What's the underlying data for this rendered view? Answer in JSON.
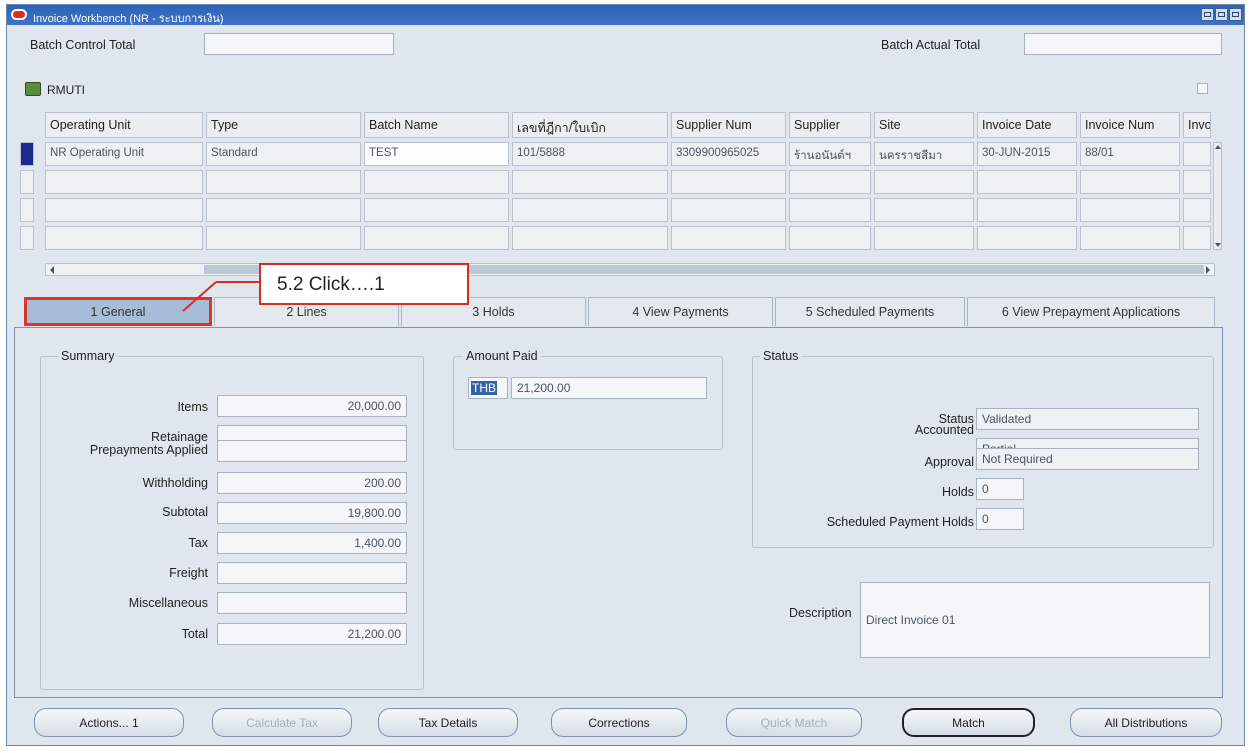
{
  "window": {
    "title": "Invoice Workbench (NR - ระบบการเงิน)"
  },
  "batch": {
    "control_total_label": "Batch Control Total",
    "control_total_value": "",
    "actual_total_label": "Batch Actual Total",
    "actual_total_value": ""
  },
  "org": {
    "name": "RMUTI"
  },
  "grid": {
    "columns": [
      "Operating Unit",
      "Type",
      "Batch Name",
      "เลขที่ฎีกา/ใบเบิก",
      "Supplier Num",
      "Supplier",
      "Site",
      "Invoice Date",
      "Invoice Num",
      "Invoi"
    ],
    "rows": [
      [
        "NR Operating Unit",
        "Standard",
        "TEST",
        "101/5888",
        "3309900965025",
        "ร้านอนันต์ฯ",
        "นครราชสีมา",
        "30-JUN-2015",
        "88/01",
        ""
      ]
    ]
  },
  "tabs": [
    {
      "label": "1 General"
    },
    {
      "label": "2 Lines"
    },
    {
      "label": "3 Holds"
    },
    {
      "label": "4 View Payments"
    },
    {
      "label": "5 Scheduled Payments"
    },
    {
      "label": "6 View Prepayment Applications"
    }
  ],
  "summary": {
    "title": "Summary",
    "items_label": "Items",
    "items_value": "20,000.00",
    "retainage_label": "Retainage",
    "retainage_value": "",
    "prepayments_label": "Prepayments Applied",
    "prepayments_value": "",
    "withholding_label": "Withholding",
    "withholding_value": "200.00",
    "subtotal_label": "Subtotal",
    "subtotal_value": "19,800.00",
    "tax_label": "Tax",
    "tax_value": "1,400.00",
    "freight_label": "Freight",
    "freight_value": "",
    "misc_label": "Miscellaneous",
    "misc_value": "",
    "total_label": "Total",
    "total_value": "21,200.00"
  },
  "amount_paid": {
    "title": "Amount Paid",
    "currency": "THB",
    "value": "21,200.00"
  },
  "status": {
    "title": "Status",
    "status_label": "Status",
    "status_value": "Validated",
    "accounted_label": "Accounted",
    "accounted_value": "Partial",
    "approval_label": "Approval",
    "approval_value": "Not Required",
    "holds_label": "Holds",
    "holds_value": "0",
    "sched_holds_label": "Scheduled Payment Holds",
    "sched_holds_value": "0"
  },
  "description": {
    "label": "Description",
    "value": "Direct Invoice 01"
  },
  "buttons": {
    "actions": "Actions... 1",
    "calculate_tax": "Calculate Tax",
    "tax_details": "Tax Details",
    "corrections": "Corrections",
    "quick_match": "Quick Match",
    "match": "Match",
    "all_distributions": "All Distributions"
  },
  "annotation": {
    "text": "5.2 Click….1"
  },
  "colors": {
    "titlebar": "#3d72c6",
    "active_tab": "#a7bcd6",
    "highlight": "#d9362c",
    "current_row": "#1b2a8c"
  }
}
